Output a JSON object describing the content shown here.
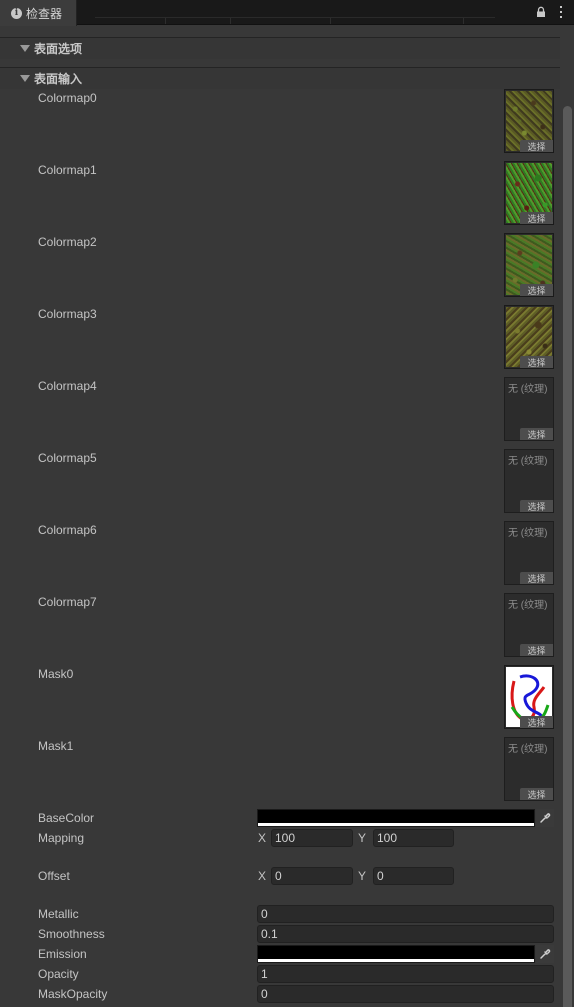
{
  "tab": {
    "title": "检查器",
    "info_icon": "info-icon"
  },
  "toolbar": {
    "lock_icon": "lock-icon",
    "more_icon": "more-vertical-icon"
  },
  "sections": {
    "surface_options": "表面选项",
    "surface_inputs": "表面输入"
  },
  "textures": [
    {
      "label": "Colormap0",
      "assigned": true,
      "none_text": "",
      "select": "选择"
    },
    {
      "label": "Colormap1",
      "assigned": true,
      "none_text": "",
      "select": "选择"
    },
    {
      "label": "Colormap2",
      "assigned": true,
      "none_text": "",
      "select": "选择"
    },
    {
      "label": "Colormap3",
      "assigned": true,
      "none_text": "",
      "select": "选择"
    },
    {
      "label": "Colormap4",
      "assigned": false,
      "none_text": "无 (纹理)",
      "select": "选择"
    },
    {
      "label": "Colormap5",
      "assigned": false,
      "none_text": "无 (纹理)",
      "select": "选择"
    },
    {
      "label": "Colormap6",
      "assigned": false,
      "none_text": "无 (纹理)",
      "select": "选择"
    },
    {
      "label": "Colormap7",
      "assigned": false,
      "none_text": "无 (纹理)",
      "select": "选择"
    },
    {
      "label": "Mask0",
      "assigned": true,
      "none_text": "",
      "select": "选择"
    },
    {
      "label": "Mask1",
      "assigned": false,
      "none_text": "无 (纹理)",
      "select": "选择"
    }
  ],
  "fields": {
    "base_color": {
      "label": "BaseColor",
      "color": "#000000"
    },
    "mapping": {
      "label": "Mapping",
      "x_label": "X",
      "x": "100",
      "y_label": "Y",
      "y": "100"
    },
    "offset": {
      "label": "Offset",
      "x_label": "X",
      "x": "0",
      "y_label": "Y",
      "y": "0"
    },
    "metallic": {
      "label": "Metallic",
      "value": "0"
    },
    "smoothness": {
      "label": "Smoothness",
      "value": "0.1"
    },
    "emission": {
      "label": "Emission",
      "color": "#000000"
    },
    "opacity": {
      "label": "Opacity",
      "value": "1"
    },
    "mask_opacity": {
      "label": "MaskOpacity",
      "value": "0"
    }
  },
  "colors": {
    "background": "#383838",
    "field_bg": "#2a2a2a",
    "tab_bar": "#191919"
  }
}
